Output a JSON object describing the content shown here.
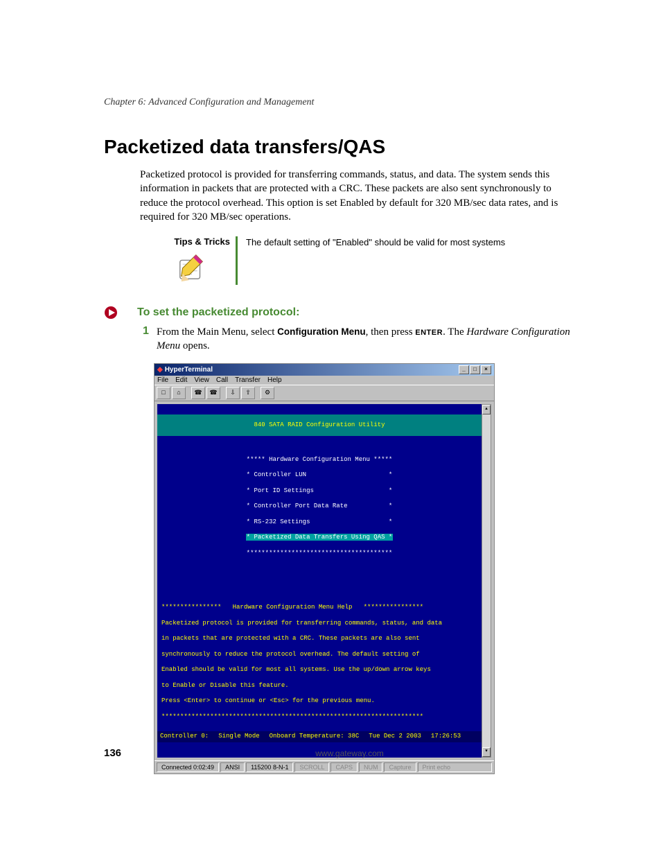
{
  "chapter_header": "Chapter 6: Advanced Configuration and Management",
  "section_title": "Packetized data transfers/QAS",
  "body_paragraph": "Packetized protocol is provided for transferring commands, status, and data. The system sends this information in packets that are protected with a CRC. These packets are also sent synchronously to reduce the protocol overhead. This option is set Enabled by default for 320 MB/sec data rates, and is required for 320 MB/sec operations.",
  "tips": {
    "label": "Tips & Tricks",
    "text": "The default setting of \"Enabled\" should be valid for most systems"
  },
  "subsection_title": "To set the packetized protocol:",
  "step": {
    "num": "1",
    "p1": "From the Main Menu, select ",
    "bold1": "Configuration Menu",
    "p2": ", then press ",
    "key": "ENTER",
    "p3": ". The ",
    "italic": "Hardware Configuration Menu",
    "p4": " opens."
  },
  "terminal": {
    "title": "HyperTerminal",
    "menu": [
      "File",
      "Edit",
      "View",
      "Call",
      "Transfer",
      "Help"
    ],
    "header": "840 SATA RAID Configuration Utility",
    "menu_title": "***** Hardware Configuration Menu *****",
    "items": [
      "* Controller LUN                      *",
      "* Port ID Settings                    *",
      "* Controller Port Data Rate           *",
      "* RS-232 Settings                     *"
    ],
    "selected": "* Packetized Data Transfers Using QAS *",
    "menu_border": "***************************************",
    "help_title": "****************   Hardware Configuration Menu Help   ****************",
    "help_lines": [
      "Packetized protocol is provided for transferring commands, status, and data",
      "in packets that are protected with a CRC. These packets are also sent",
      "synchronously to reduce the protocol overhead. The default setting of",
      "Enabled should be valid for most all systems. Use the up/down arrow keys",
      "to Enable or Disable this feature.",
      "Press <Enter> to continue or <Esc> for the previous menu."
    ],
    "help_border": "**********************************************************************",
    "status": {
      "controller": "Controller 0:",
      "mode": "Single Mode",
      "temp": "Onboard Temperature: 38C",
      "date": "Tue Dec 2 2003",
      "time": "17:26:53"
    },
    "statusbar": {
      "connected": "Connected 0:02:49",
      "emulation": "ANSI",
      "settings": "115200 8-N-1",
      "scroll": "SCROLL",
      "caps": "CAPS",
      "num": "NUM",
      "capture": "Capture",
      "printecho": "Print echo"
    }
  },
  "footer": {
    "page_num": "136",
    "url": "www.gateway.com"
  }
}
